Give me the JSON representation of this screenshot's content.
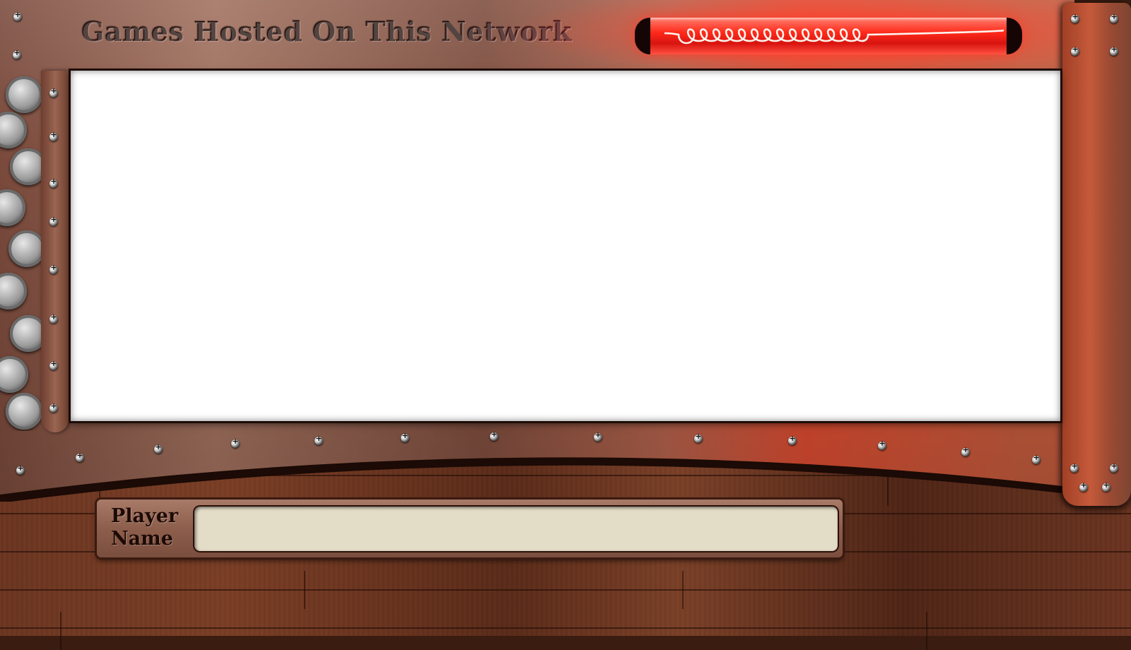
{
  "header": {
    "title": "Games Hosted On This Network"
  },
  "player_panel": {
    "label_line1": "Player",
    "label_line2": "Name",
    "input_value": "",
    "input_placeholder": ""
  },
  "theme": {
    "frame_copper": "#a0705e",
    "neon_red": "#ff2a1a",
    "viewport_bg": "#ffffff",
    "wood": "#6b3520",
    "field_bg": "#e3dcc6"
  },
  "decor": {
    "tube_icon": "neon-tube-icon",
    "gear_icon": "gear-icon",
    "rivet_icon": "rivet-icon"
  }
}
